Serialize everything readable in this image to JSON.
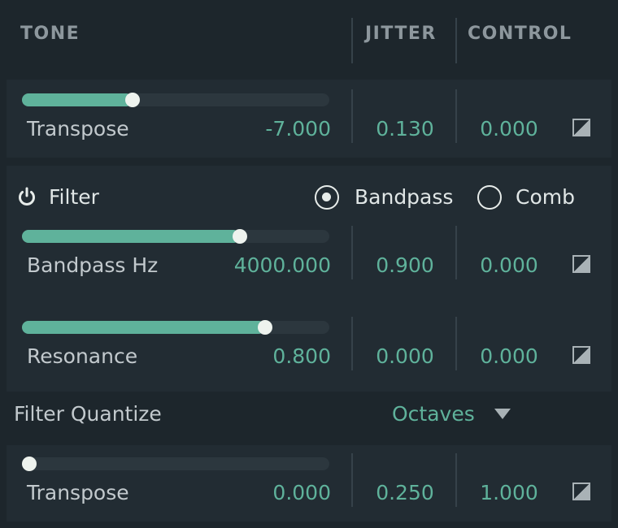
{
  "header": {
    "tone": "TONE",
    "jitter": "JITTER",
    "control": "CONTROL"
  },
  "colors": {
    "accent": "#5fb29b",
    "background": "#1d262c",
    "panel": "#222c33"
  },
  "rows": {
    "transpose1": {
      "label": "Transpose",
      "value": "-7.000",
      "jitter": "0.130",
      "control": "0.000",
      "slider_fraction": 0.36
    },
    "bandpass": {
      "label": "Bandpass Hz",
      "value": "4000.000",
      "jitter": "0.900",
      "control": "0.000",
      "slider_fraction": 0.71
    },
    "resonance": {
      "label": "Resonance",
      "value": "0.800",
      "jitter": "0.000",
      "control": "0.000",
      "slider_fraction": 0.79
    },
    "transpose2": {
      "label": "Transpose",
      "value": "0.000",
      "jitter": "0.250",
      "control": "1.000",
      "slider_fraction": 0.0
    }
  },
  "filter": {
    "label": "Filter",
    "power_icon": "power-icon",
    "options": [
      "Bandpass",
      "Comb"
    ],
    "selected": "Bandpass"
  },
  "quantize": {
    "label": "Filter Quantize",
    "value": "Octaves",
    "icon": "triangle-down-icon"
  }
}
